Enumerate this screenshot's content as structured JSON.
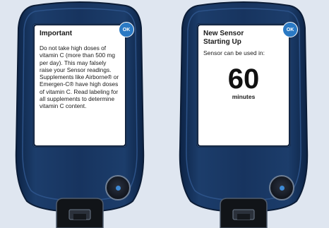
{
  "devices": [
    {
      "screen": {
        "title": "Important",
        "body": "Do not take high doses of vitamin C (more than 500 mg per day). This may falsely raise your Sensor readings. Supplements like Airborne® or Emergen-C® have high doses of vitamin C. Read labeling for all supplements to determine vitamin C content."
      },
      "ok_label": "OK"
    },
    {
      "screen": {
        "title": "New Sensor Starting Up",
        "subtitle": "Sensor can be used in:",
        "countdown": "60",
        "unit": "minutes"
      },
      "ok_label": "OK"
    }
  ],
  "colors": {
    "device_body": "#17345f",
    "device_rim": "#0f2344",
    "ok_button": "#2a79c4",
    "home_button_light": "#3e8ad6"
  },
  "icons": {
    "home_button": "home-button-icon",
    "usb_port": "usb-port-icon"
  }
}
